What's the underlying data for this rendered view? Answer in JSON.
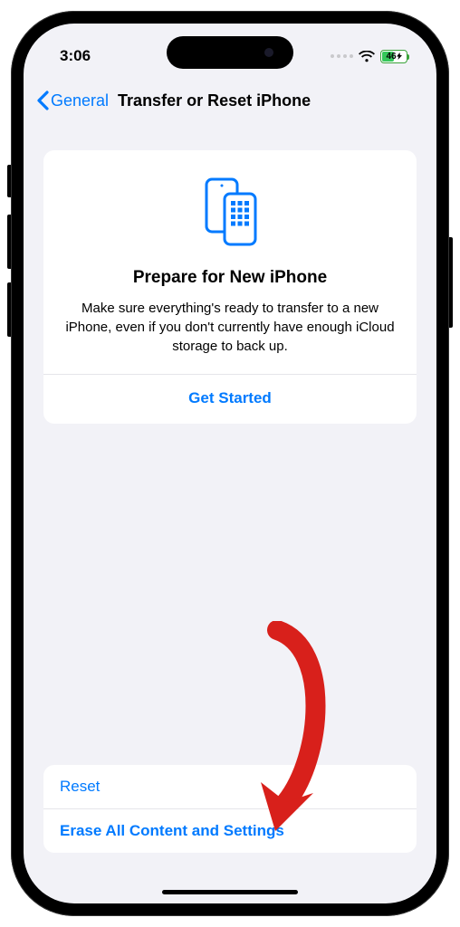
{
  "status": {
    "time": "3:06",
    "battery_percent": "46"
  },
  "nav": {
    "back_label": "General",
    "title": "Transfer or Reset iPhone"
  },
  "prepare_card": {
    "title": "Prepare for New iPhone",
    "description": "Make sure everything's ready to transfer to a new iPhone, even if you don't currently have enough iCloud storage to back up.",
    "cta": "Get Started"
  },
  "bottom": {
    "reset": "Reset",
    "erase": "Erase All Content and Settings"
  },
  "colors": {
    "ios_blue": "#007aff",
    "bg": "#f2f2f7",
    "battery_green": "#34c759",
    "annotation_red": "#d8201b"
  }
}
